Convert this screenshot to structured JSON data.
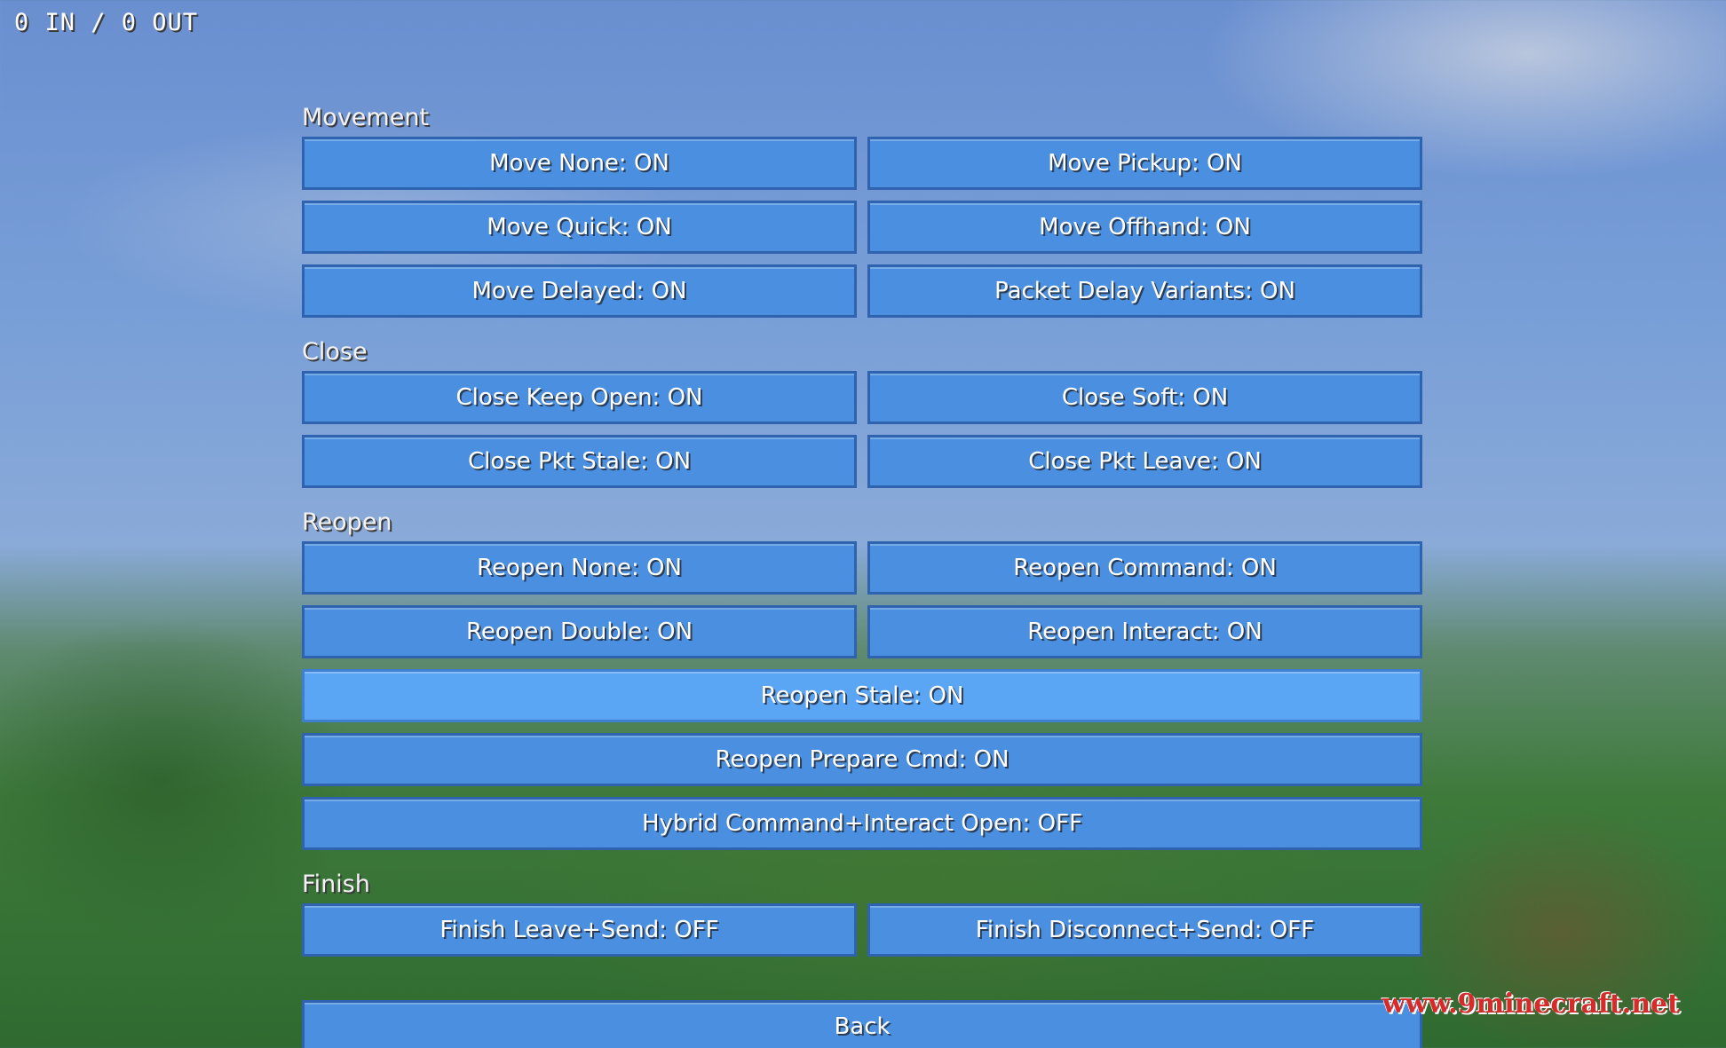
{
  "hud": {
    "counter": "0 IN / 0 OUT"
  },
  "sections": {
    "movement": {
      "title": "Movement",
      "buttons": [
        "Move None: ON",
        "Move Pickup: ON",
        "Move Quick: ON",
        "Move Offhand: ON",
        "Move Delayed: ON",
        "Packet Delay Variants: ON"
      ]
    },
    "close": {
      "title": "Close",
      "buttons": [
        "Close Keep Open: ON",
        "Close Soft: ON",
        "Close Pkt Stale: ON",
        "Close Pkt Leave: ON"
      ]
    },
    "reopen": {
      "title": "Reopen",
      "buttons": [
        "Reopen None: ON",
        "Reopen Command: ON",
        "Reopen Double: ON",
        "Reopen Interact: ON",
        "Reopen Stale: ON",
        "Reopen Prepare Cmd: ON",
        "Hybrid Command+Interact Open: OFF"
      ]
    },
    "finish": {
      "title": "Finish",
      "buttons": [
        "Finish Leave+Send: OFF",
        "Finish Disconnect+Send: OFF"
      ]
    }
  },
  "back_label": "Back",
  "watermark": "www.9minecraft.net",
  "colors": {
    "button": "#4a8fe0",
    "button_border": "#2f63b0",
    "button_hover": "#5aa6f5",
    "watermark": "#d62b2b"
  }
}
